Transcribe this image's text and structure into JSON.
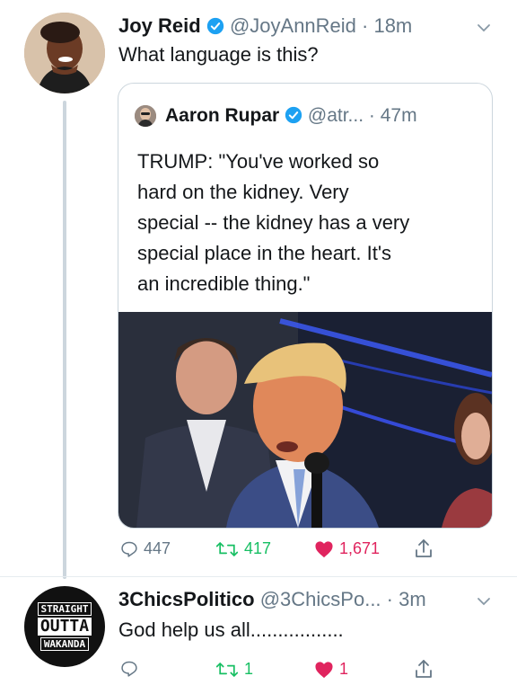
{
  "tweet": {
    "author_name": "Joy Reid",
    "handle_time": "@JoyAnnReid · 18m",
    "text": "What language is this?"
  },
  "quoted": {
    "author_name": "Aaron Rupar",
    "handle_time": "@atr... · 47m",
    "lines": [
      "TRUMP: \"You've worked so",
      "hard on the kidney. Very",
      "special -- the kidney has a very",
      "special place in the heart. It's",
      "an incredible thing.\""
    ]
  },
  "actions": {
    "reply_count": "447",
    "retweet_count": "417",
    "like_count": "1,671"
  },
  "reply": {
    "author_name": "3ChicsPolitico",
    "handle_time": "@3ChicsPo... · 3m",
    "text": "God help us all.................",
    "avatar_text": [
      "STRAIGHT",
      "OUTTA",
      "WAKANDA"
    ],
    "retweet_count": "1",
    "like_count": "1"
  },
  "colors": {
    "verified_blue": "#1da1f2",
    "retweet_green": "#17bf63",
    "like_red": "#e0245e",
    "muted_gray": "#657786"
  },
  "icons": [
    "verified-icon",
    "chevron-down-icon",
    "reply-icon",
    "retweet-icon",
    "heart-icon",
    "share-icon"
  ]
}
